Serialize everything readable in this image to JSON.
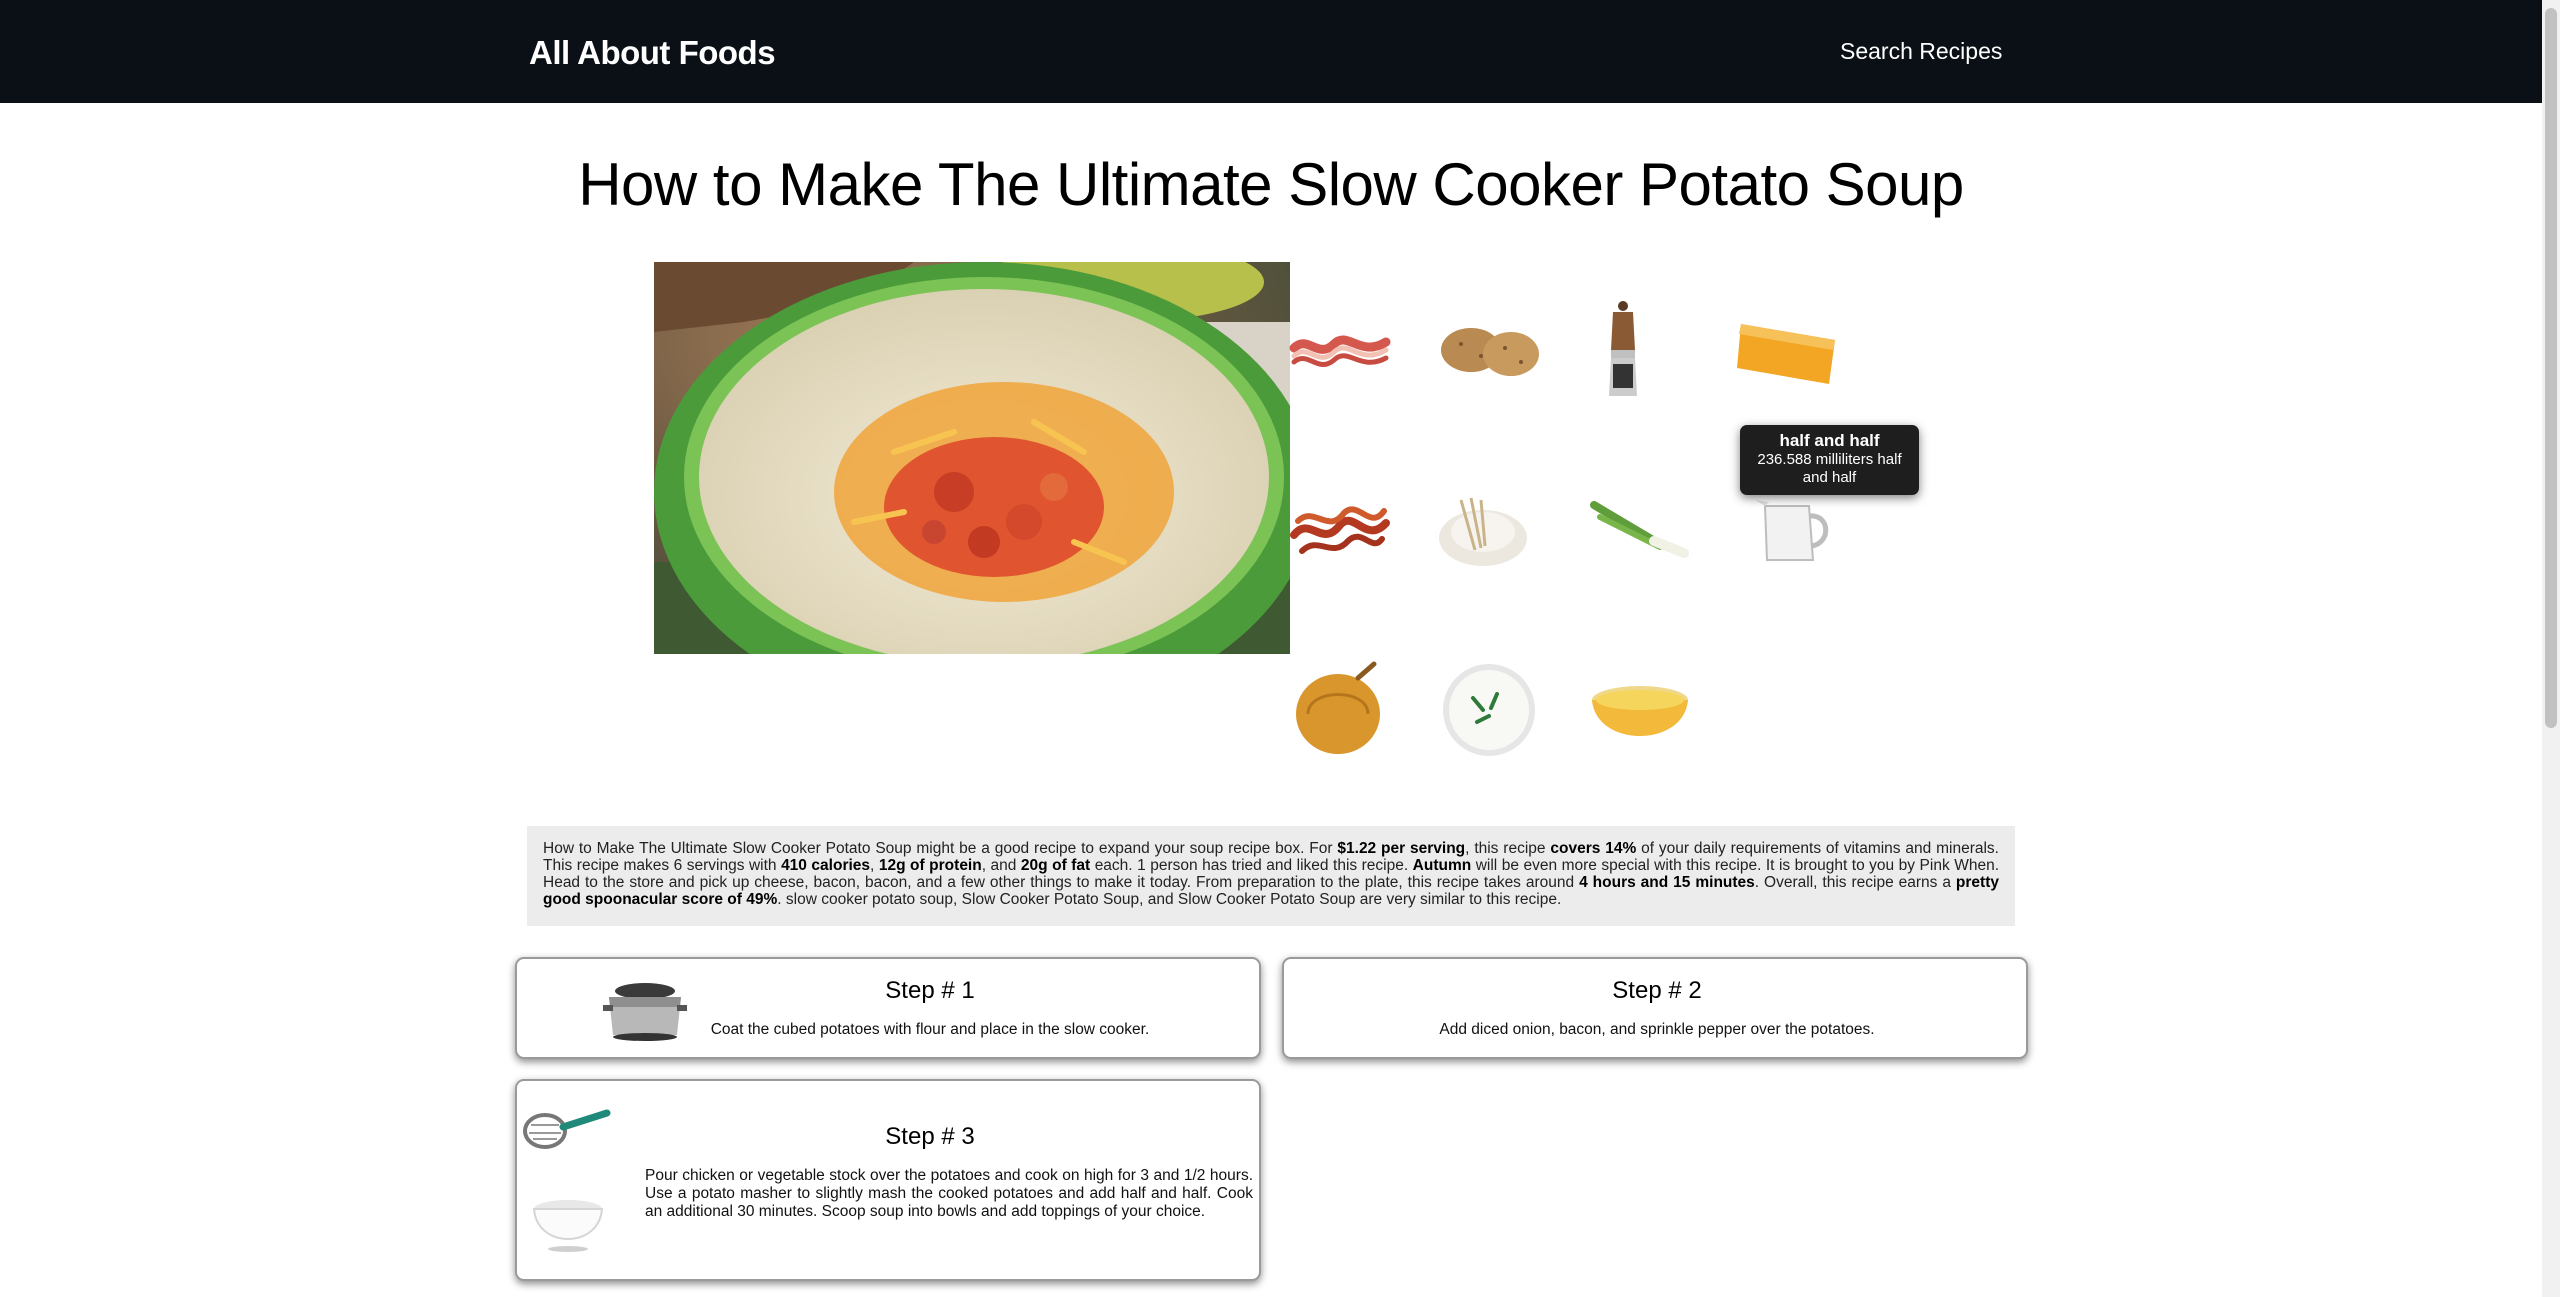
{
  "nav": {
    "brand": "All About Foods",
    "search_link": "Search Recipes"
  },
  "page": {
    "title": "How to Make The Ultimate Slow Cooker Potato Soup"
  },
  "ingredients": [
    {
      "name": "bacon",
      "icon": "bacon-strips-icon"
    },
    {
      "name": "potatoes",
      "icon": "potatoes-icon"
    },
    {
      "name": "pepper",
      "icon": "pepper-grinder-icon"
    },
    {
      "name": "cheese",
      "icon": "cheddar-cheese-icon"
    },
    {
      "name": "bacon",
      "icon": "cooked-bacon-icon"
    },
    {
      "name": "flour",
      "icon": "flour-icon"
    },
    {
      "name": "green onions",
      "icon": "green-onion-icon"
    },
    {
      "name": "half and half",
      "icon": "milk-pitcher-icon"
    },
    {
      "name": "onion",
      "icon": "onion-icon"
    },
    {
      "name": "sour cream",
      "icon": "sour-cream-icon"
    },
    {
      "name": "stock",
      "icon": "broth-bowl-icon"
    }
  ],
  "tooltip": {
    "title": "half and half",
    "detail": "236.588 milliliters half and half"
  },
  "summary": {
    "p1": "How to Make The Ultimate Slow Cooker Potato Soup might be a good recipe to expand your soup recipe box. For ",
    "b1": "$1.22 per serving",
    "p2": ", this recipe ",
    "b2": "covers 14%",
    "p3": " of your daily requirements of vitamins and minerals. This recipe makes 6 servings with ",
    "b3": "410 calories",
    "p4": ", ",
    "b4": "12g of protein",
    "p5": ", and ",
    "b5": "20g of fat",
    "p6": " each. 1 person has tried and liked this recipe. ",
    "b6": "Autumn",
    "p7": " will be even more special with this recipe. It is brought to you by Pink When. Head to the store and pick up cheese, bacon, bacon, and a few other things to make it today. From preparation to the plate, this recipe takes around ",
    "b7": "4 hours and 15 minutes",
    "p8": ". Overall, this recipe earns a ",
    "b8": "pretty good spoonacular score of 49%",
    "p9": ". slow cooker potato soup, Slow Cooker Potato Soup, and Slow Cooker Potato Soup are very similar to this recipe."
  },
  "steps": [
    {
      "title": "Step # 1",
      "text": "Coat the cubed potatoes with flour and place in the slow cooker.",
      "icons": [
        "slow-cooker-icon"
      ]
    },
    {
      "title": "Step # 2",
      "text": "Add diced onion, bacon, and sprinkle pepper over the potatoes.",
      "icons": []
    },
    {
      "title": "Step # 3",
      "text": "Pour chicken or vegetable stock over the potatoes and cook on high for 3 and 1/2 hours. Use a potato masher to slightly mash the cooked potatoes and add half and half. Cook an additional 30 minutes. Scoop soup into bowls and add toppings of your choice.",
      "icons": [
        "potato-masher-icon",
        "bowl-icon"
      ]
    }
  ]
}
